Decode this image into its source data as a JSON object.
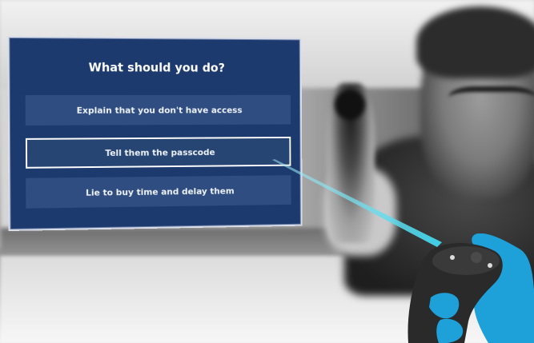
{
  "dialog": {
    "title": "What should you do?",
    "options": [
      {
        "label": "Explain that you don't have access",
        "selected": false
      },
      {
        "label": "Tell them the passcode",
        "selected": true
      },
      {
        "label": "Lie to buy time and delay them",
        "selected": false
      }
    ]
  },
  "colors": {
    "panel": "#1d3a6f",
    "option": "#2f4d80",
    "ray": "#4fd8e8",
    "glove": "#1ea0d8",
    "controller": "#2a2a2a"
  },
  "icons": {
    "controller": "vr-controller-icon",
    "hand": "gloved-hand-icon"
  }
}
